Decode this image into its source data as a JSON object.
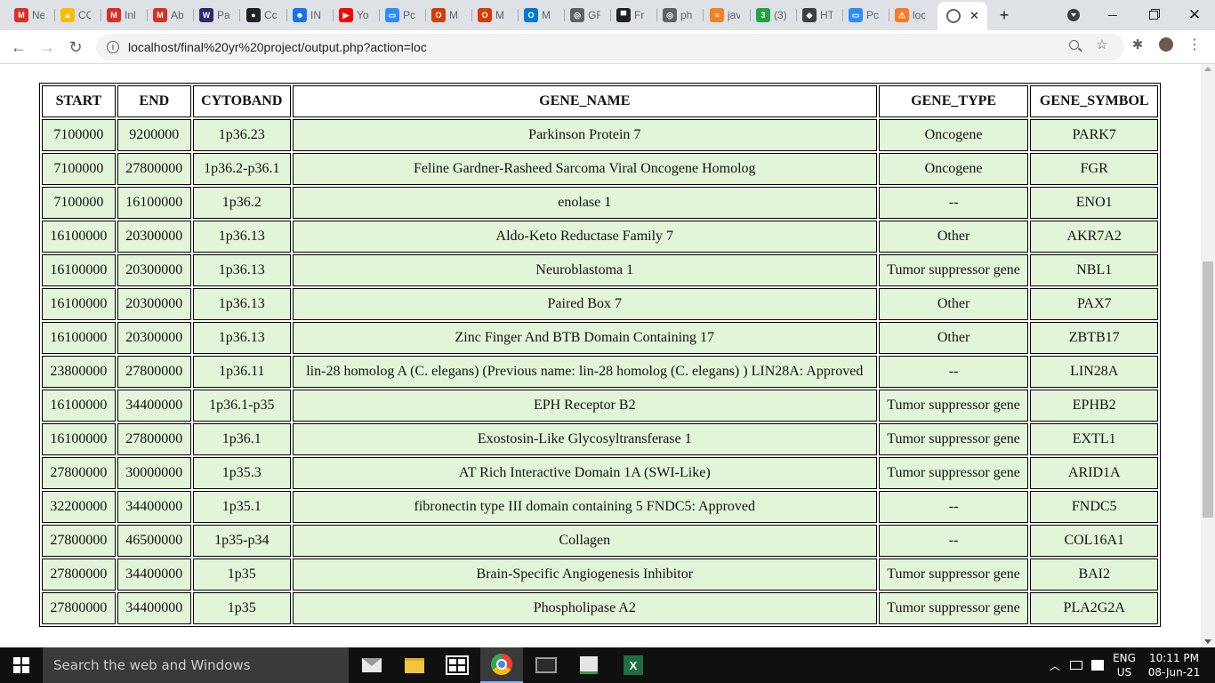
{
  "browser": {
    "tabs": [
      {
        "label": "Ne",
        "icon": "gmail-icon",
        "color": "#d93025",
        "glyph": "M"
      },
      {
        "label": "CC",
        "icon": "google-drive-icon",
        "color": "#fbbc04",
        "glyph": "▲"
      },
      {
        "label": "Inl",
        "icon": "gmail-icon",
        "color": "#d93025",
        "glyph": "M"
      },
      {
        "label": "Ab",
        "icon": "gmail-icon",
        "color": "#d93025",
        "glyph": "M"
      },
      {
        "label": "Pa",
        "icon": "app-icon",
        "color": "#2b2a6b",
        "glyph": "W"
      },
      {
        "label": "Cc",
        "icon": "github-icon",
        "color": "#202124",
        "glyph": "●"
      },
      {
        "label": "IN",
        "icon": "contact-icon",
        "color": "#1a73e8",
        "glyph": "☻"
      },
      {
        "label": "Yo",
        "icon": "youtube-icon",
        "color": "#ff0000",
        "glyph": "▶"
      },
      {
        "label": "Pc",
        "icon": "zoom-icon",
        "color": "#2d8cff",
        "glyph": "▭"
      },
      {
        "label": "M",
        "icon": "office-icon",
        "color": "#d83b01",
        "glyph": "O"
      },
      {
        "label": "M",
        "icon": "office-icon",
        "color": "#d83b01",
        "glyph": "O"
      },
      {
        "label": "M",
        "icon": "outlook-icon",
        "color": "#0078d4",
        "glyph": "O"
      },
      {
        "label": "GF",
        "icon": "globe-icon",
        "color": "#5f6368",
        "glyph": "◎"
      },
      {
        "label": "Fr",
        "icon": "site-icon",
        "color": "#202124",
        "glyph": "▀"
      },
      {
        "label": "ph",
        "icon": "globe-icon",
        "color": "#5f6368",
        "glyph": "◎"
      },
      {
        "label": "jav",
        "icon": "stackoverflow-icon",
        "color": "#f48024",
        "glyph": "≡"
      },
      {
        "label": "(3)",
        "icon": "whatsapp-icon",
        "color": "#25a244",
        "glyph": "3"
      },
      {
        "label": "HT",
        "icon": "diamond-icon",
        "color": "#3c4043",
        "glyph": "◈"
      },
      {
        "label": "Pc",
        "icon": "zoom-icon",
        "color": "#2d8cff",
        "glyph": "▭"
      },
      {
        "label": "loc",
        "icon": "xampp-icon",
        "color": "#fb7a24",
        "glyph": "⚠"
      }
    ],
    "active_tab": {
      "icon": "globe-icon",
      "close": "✕"
    },
    "new_tab": "+",
    "url": "localhost/final%20yr%20project/output.php?action=loc"
  },
  "table": {
    "headers": [
      "START",
      "END",
      "CYTOBAND",
      "GENE_NAME",
      "GENE_TYPE",
      "GENE_SYMBOL"
    ],
    "rows": [
      [
        "7100000",
        "9200000",
        "1p36.23",
        "Parkinson Protein 7",
        "Oncogene",
        "PARK7"
      ],
      [
        "7100000",
        "27800000",
        "1p36.2-p36.1",
        "Feline Gardner-Rasheed Sarcoma Viral Oncogene Homolog",
        "Oncogene",
        "FGR"
      ],
      [
        "7100000",
        "16100000",
        "1p36.2",
        "enolase 1",
        "--",
        "ENO1"
      ],
      [
        "16100000",
        "20300000",
        "1p36.13",
        "Aldo-Keto Reductase Family 7",
        "Other",
        "AKR7A2"
      ],
      [
        "16100000",
        "20300000",
        "1p36.13",
        "Neuroblastoma 1",
        "Tumor suppressor gene",
        "NBL1"
      ],
      [
        "16100000",
        "20300000",
        "1p36.13",
        "Paired Box 7",
        "Other",
        "PAX7"
      ],
      [
        "16100000",
        "20300000",
        "1p36.13",
        "Zinc Finger And BTB Domain Containing 17",
        "Other",
        "ZBTB17"
      ],
      [
        "23800000",
        "27800000",
        "1p36.11",
        "lin-28 homolog A (C. elegans) (Previous name: lin-28 homolog (C. elegans) ) LIN28A: Approved",
        "--",
        "LIN28A"
      ],
      [
        "16100000",
        "34400000",
        "1p36.1-p35",
        "EPH Receptor B2",
        "Tumor suppressor gene",
        "EPHB2"
      ],
      [
        "16100000",
        "27800000",
        "1p36.1",
        "Exostosin-Like Glycosyltransferase 1",
        "Tumor suppressor gene",
        "EXTL1"
      ],
      [
        "27800000",
        "30000000",
        "1p35.3",
        "AT Rich Interactive Domain 1A (SWI-Like)",
        "Tumor suppressor gene",
        "ARID1A"
      ],
      [
        "32200000",
        "34400000",
        "1p35.1",
        "fibronectin type III domain containing 5 FNDC5: Approved",
        "--",
        "FNDC5"
      ],
      [
        "27800000",
        "46500000",
        "1p35-p34",
        "Collagen",
        "--",
        "COL16A1"
      ],
      [
        "27800000",
        "34400000",
        "1p35",
        "Brain-Specific Angiogenesis Inhibitor",
        "Tumor suppressor gene",
        "BAI2"
      ],
      [
        "27800000",
        "34400000",
        "1p35",
        "Phospholipase A2",
        "Tumor suppressor gene",
        "PLA2G2A"
      ]
    ]
  },
  "taskbar": {
    "search_placeholder": "Search the web and Windows",
    "lang_top": "ENG",
    "lang_bottom": "US",
    "time": "10:11 PM",
    "date": "08-Jun-21"
  },
  "colors": {
    "cell_background": "#e3f5d8",
    "tabstrip": "#dee1e6",
    "taskbar": "#101010"
  }
}
